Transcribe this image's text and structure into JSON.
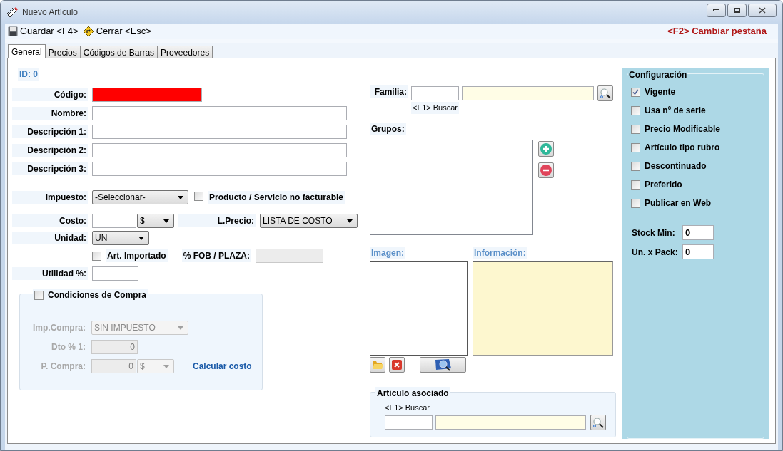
{
  "window": {
    "title": "Nuevo Artículo"
  },
  "toolbar": {
    "buttons": [
      {
        "label": "Guardar <F4>",
        "kind": "save"
      },
      {
        "label": "Cerrar <Esc>",
        "kind": "close"
      }
    ],
    "hint": "<F2> Cambiar pestaña"
  },
  "tabs": [
    {
      "label": "General",
      "selected": true
    },
    {
      "label": "Precios",
      "selected": false
    },
    {
      "label": "Códigos de Barras",
      "selected": false
    },
    {
      "label": "Proveedores",
      "selected": false
    }
  ],
  "id_label": "ID: 0",
  "fields": [
    {
      "label": "Código:",
      "kind": "required"
    },
    {
      "label": "Nombre:",
      "kind": "text"
    },
    {
      "label": "Descripción 1:",
      "kind": "text"
    },
    {
      "label": "Descripción 2:",
      "kind": "text"
    },
    {
      "label": "Descripción 3:",
      "kind": "text"
    }
  ],
  "impuesto": {
    "label": "Impuesto:",
    "value": "-Seleccionar-"
  },
  "no_facturable": {
    "label": "Producto / Servicio no facturable",
    "checked": false
  },
  "costo": {
    "label": "Costo:",
    "currency": "$"
  },
  "lista_precio": {
    "label": "L.Precio:",
    "value": "LISTA DE COSTO"
  },
  "unidad": {
    "label": "Unidad:",
    "value": "UN"
  },
  "importado": {
    "label": "Art. Importado",
    "checked": false
  },
  "fob": {
    "label": "% FOB / PLAZA:",
    "disabled": true
  },
  "utilidad": {
    "label": "Utilidad %:"
  },
  "condiciones": {
    "label": "Condiciones de Compra",
    "checked": false,
    "imp_label": "Imp.Compra:",
    "imp_value": "SIN IMPUESTO",
    "dto_label": "Dto % 1:",
    "dto_value": "0",
    "pc_label": "P. Compra:",
    "pc_value": "0",
    "pc_currency": "$",
    "link": "Calcular costo"
  },
  "familia": {
    "label": "Familia:",
    "hint": "<F1> Buscar"
  },
  "grupos": {
    "label": "Grupos:"
  },
  "imagen": {
    "label": "Imagen:"
  },
  "informacion": {
    "label": "Información:"
  },
  "asociado": {
    "title": "Artículo asociado",
    "hint": "<F1> Buscar"
  },
  "configuracion": {
    "title": "Configuración",
    "options": [
      {
        "label": "Vigente",
        "checked": true
      },
      {
        "label": "Usa nº de serie",
        "checked": false
      },
      {
        "label": "Precio Modificable",
        "checked": false
      },
      {
        "label": "Artículo tipo rubro",
        "checked": false
      },
      {
        "label": "Descontinuado",
        "checked": false
      },
      {
        "label": "Preferido",
        "checked": false
      },
      {
        "label": "Publicar en Web",
        "checked": false
      }
    ],
    "stock_min": {
      "label": "Stock Min:",
      "value": "0"
    },
    "pack": {
      "label": "Un. x Pack:",
      "value": "0"
    }
  }
}
